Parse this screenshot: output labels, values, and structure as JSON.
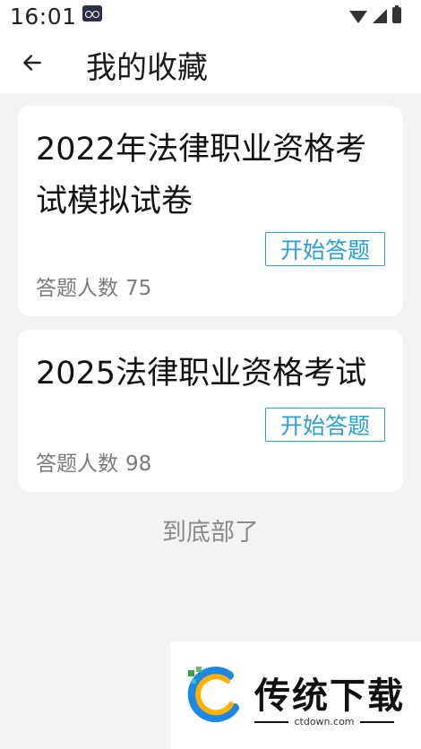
{
  "status_bar": {
    "time": "16:01",
    "icons": [
      "app-notification-icon",
      "wifi-icon",
      "signal-icon",
      "battery-icon"
    ]
  },
  "app_bar": {
    "back_icon": "arrow-left-icon",
    "title": "我的收藏"
  },
  "favorites": [
    {
      "title": "2022年法律职业资格考试模拟试卷",
      "button_label": "开始答题",
      "count_label": "答题人数",
      "count": "75"
    },
    {
      "title": "2025法律职业资格考试",
      "button_label": "开始答题",
      "count_label": "答题人数",
      "count": "98"
    }
  ],
  "end_text": "到底部了",
  "watermark": {
    "brand": "传统下载",
    "site": "ctdown.com"
  },
  "colors": {
    "accent": "#2a9fd6",
    "background": "#f3f3f5",
    "card": "#ffffff",
    "secondary_text": "#7a7a7a"
  }
}
